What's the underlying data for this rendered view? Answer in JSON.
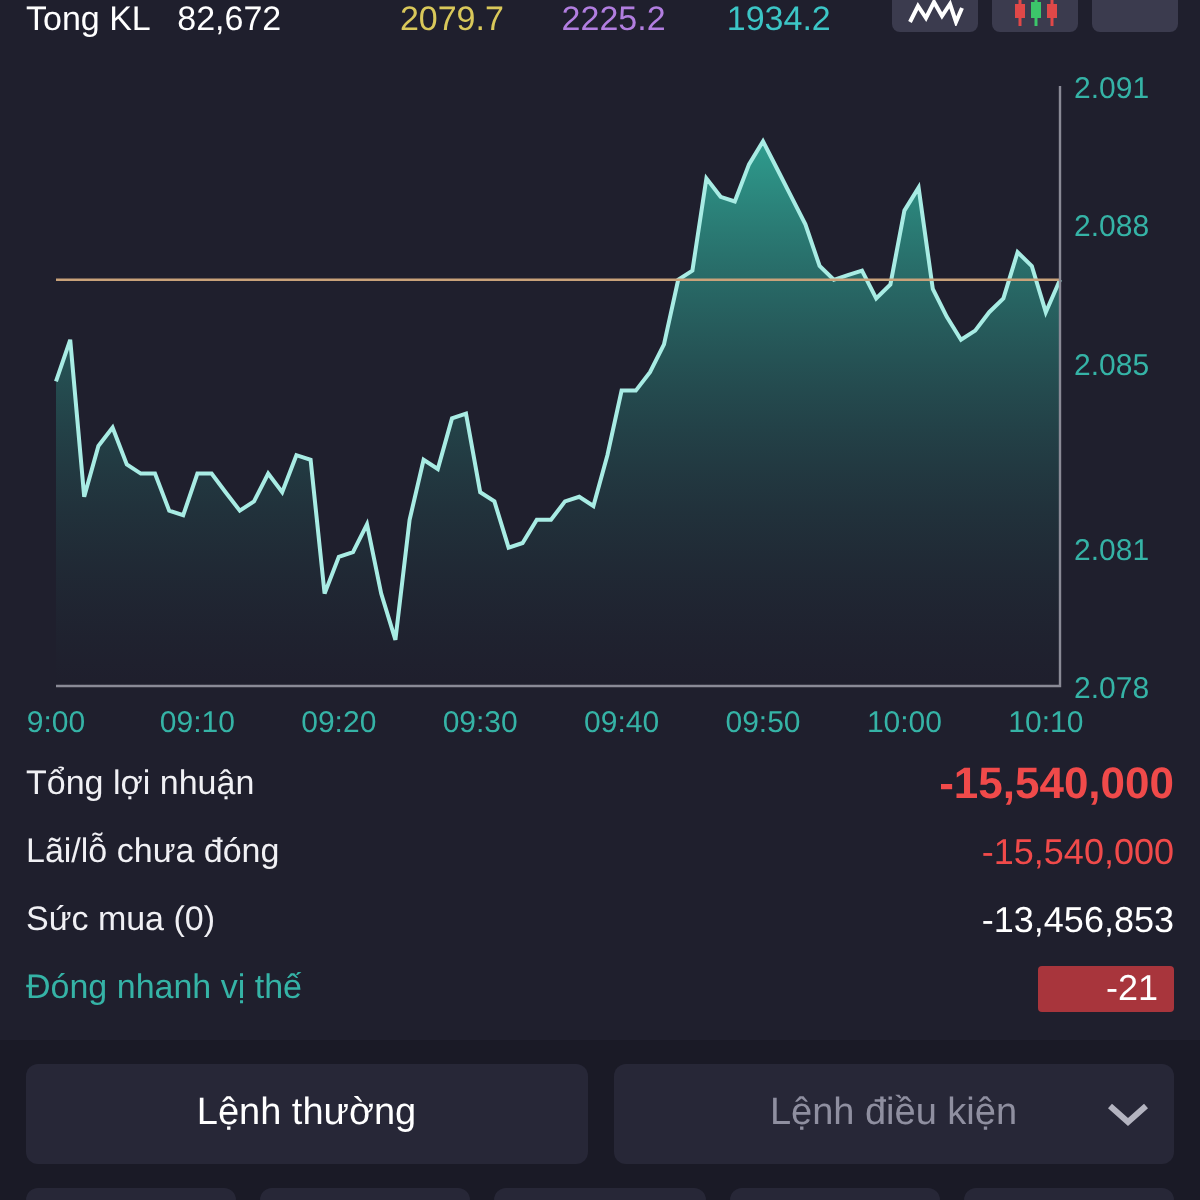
{
  "header": {
    "label": "Tong KL",
    "volume": "82,672",
    "prices": [
      {
        "value": "2079.7",
        "color": "#d9c85a"
      },
      {
        "value": "2225.2",
        "color": "#b27ee0"
      },
      {
        "value": "1934.2",
        "color": "#3cc6c6"
      }
    ]
  },
  "chart": {
    "chart_data": {
      "type": "area",
      "categories": [
        "9:00",
        null,
        null,
        null,
        null,
        null,
        null,
        null,
        null,
        null,
        "09:10",
        null,
        null,
        null,
        null,
        null,
        null,
        null,
        null,
        null,
        "09:20",
        null,
        null,
        null,
        null,
        null,
        null,
        null,
        null,
        null,
        "09:30",
        null,
        null,
        null,
        null,
        null,
        null,
        null,
        null,
        null,
        "09:40",
        null,
        null,
        null,
        null,
        null,
        null,
        null,
        null,
        null,
        "09:50",
        null,
        null,
        null,
        null,
        null,
        null,
        null,
        null,
        null,
        "10:00",
        null,
        null,
        null,
        null,
        null,
        null,
        null,
        null,
        null,
        "10:10",
        null
      ],
      "series": [
        {
          "type": "area",
          "color": "#a8ece4",
          "values": [
            2.0846,
            2.0855,
            2.0821,
            2.0832,
            2.0836,
            2.0828,
            2.0826,
            2.0826,
            2.0818,
            2.0817,
            2.0826,
            2.0826,
            2.0822,
            2.0818,
            2.082,
            2.0826,
            2.0822,
            2.083,
            2.0829,
            2.08,
            2.0808,
            2.0809,
            2.0815,
            2.08,
            2.079,
            2.0816,
            2.0829,
            2.0827,
            2.0838,
            2.0839,
            2.0822,
            2.082,
            2.081,
            2.0811,
            2.0816,
            2.0816,
            2.082,
            2.0821,
            2.0819,
            2.083,
            2.0844,
            2.0844,
            2.0848,
            2.0854,
            2.0868,
            2.087,
            2.089,
            2.0886,
            2.0885,
            2.0893,
            2.0898,
            2.0892,
            2.0886,
            2.088,
            2.0871,
            2.0868,
            2.0869,
            2.087,
            2.0864,
            2.0867,
            2.0883,
            2.0888,
            2.0866,
            2.086,
            2.0855,
            2.0857,
            2.0861,
            2.0864,
            2.0874,
            2.0871,
            2.0861,
            2.0868
          ]
        },
        {
          "type": "line",
          "color": "#c9a27a",
          "values": [
            2.0868,
            2.0868,
            2.0868,
            2.0868,
            2.0868,
            2.0868,
            2.0868,
            2.0868,
            2.0868,
            2.0868,
            2.0868,
            2.0868,
            2.0868,
            2.0868,
            2.0868,
            2.0868,
            2.0868,
            2.0868,
            2.0868,
            2.0868,
            2.0868,
            2.0868,
            2.0868,
            2.0868,
            2.0868,
            2.0868,
            2.0868,
            2.0868,
            2.0868,
            2.0868,
            2.0868,
            2.0868,
            2.0868,
            2.0868,
            2.0868,
            2.0868,
            2.0868,
            2.0868,
            2.0868,
            2.0868,
            2.0868,
            2.0868,
            2.0868,
            2.0868,
            2.0868,
            2.0868,
            2.0868,
            2.0868,
            2.0868,
            2.0868,
            2.0868,
            2.0868,
            2.0868,
            2.0868,
            2.0868,
            2.0868,
            2.0868,
            2.0868,
            2.0868,
            2.0868,
            2.0868,
            2.0868,
            2.0868,
            2.0868,
            2.0868,
            2.0868,
            2.0868,
            2.0868,
            2.0868,
            2.0868,
            2.0868,
            2.0868
          ]
        }
      ],
      "ylim": [
        2.078,
        2.091
      ],
      "yticks": [
        2.091,
        2.088,
        2.085,
        2.081,
        2.078
      ]
    }
  },
  "stats": [
    {
      "kind": "total",
      "label": "Tổng lợi nhuận",
      "value": "-15,540,000"
    },
    {
      "kind": "loss",
      "label": "Lãi/lỗ chưa đóng",
      "value": "-15,540,000"
    },
    {
      "kind": "plain",
      "label": "Sức mua (0)",
      "value": "-13,456,853"
    },
    {
      "kind": "badge",
      "label": "Đóng nhanh vị thế",
      "value": "-21"
    }
  ],
  "order_tabs": [
    {
      "label": "Lệnh thường",
      "selected": true,
      "dropdown": false
    },
    {
      "label": "Lệnh điều kiện",
      "selected": false,
      "dropdown": true
    }
  ]
}
